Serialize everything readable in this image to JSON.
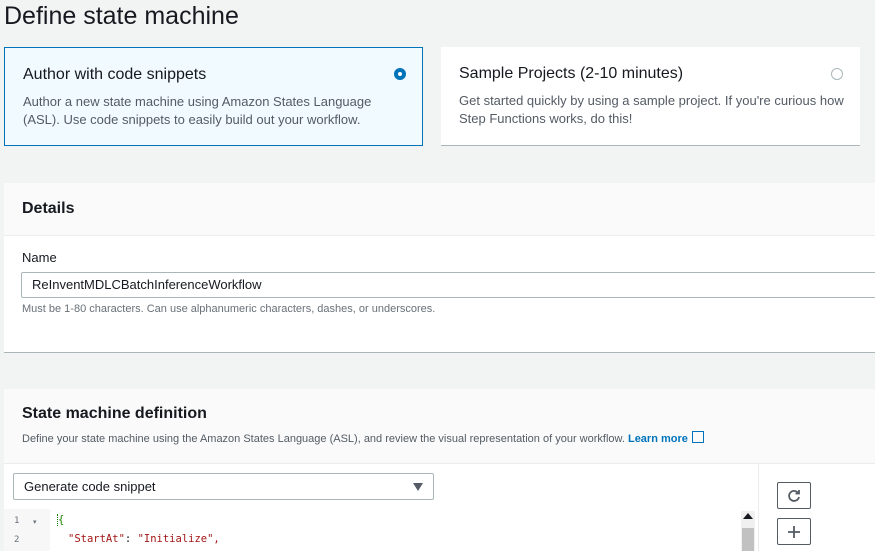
{
  "page": {
    "title": "Define state machine"
  },
  "tiles": [
    {
      "title": "Author with code snippets",
      "description": "Author a new state machine using Amazon States Language (ASL). Use code snippets to easily build out your workflow.",
      "selected": true
    },
    {
      "title": "Sample Projects (2-10 minutes)",
      "description": "Get started quickly by using a sample project. If you're curious how Step Functions works, do this!",
      "selected": false
    }
  ],
  "details": {
    "heading": "Details",
    "name_label": "Name",
    "name_value": "ReInventMDLCBatchInferenceWorkflow",
    "name_hint": "Must be 1-80 characters. Can use alphanumeric characters, dashes, or underscores."
  },
  "definition": {
    "heading": "State machine definition",
    "description": "Define your state machine using the Amazon States Language (ASL), and review the visual representation of your workflow.",
    "learn_more": "Learn more",
    "snippet_select": "Generate code snippet",
    "lines": [
      {
        "num": "1",
        "text": "{"
      },
      {
        "num": "2",
        "key": "\"StartAt\"",
        "value": "\"Initialize\","
      }
    ]
  },
  "icons": {
    "refresh": "refresh-icon",
    "zoom_in": "plus-icon",
    "external": "external-link-icon"
  },
  "colors": {
    "accent": "#0073bb",
    "selected_bg": "#f1faff"
  }
}
